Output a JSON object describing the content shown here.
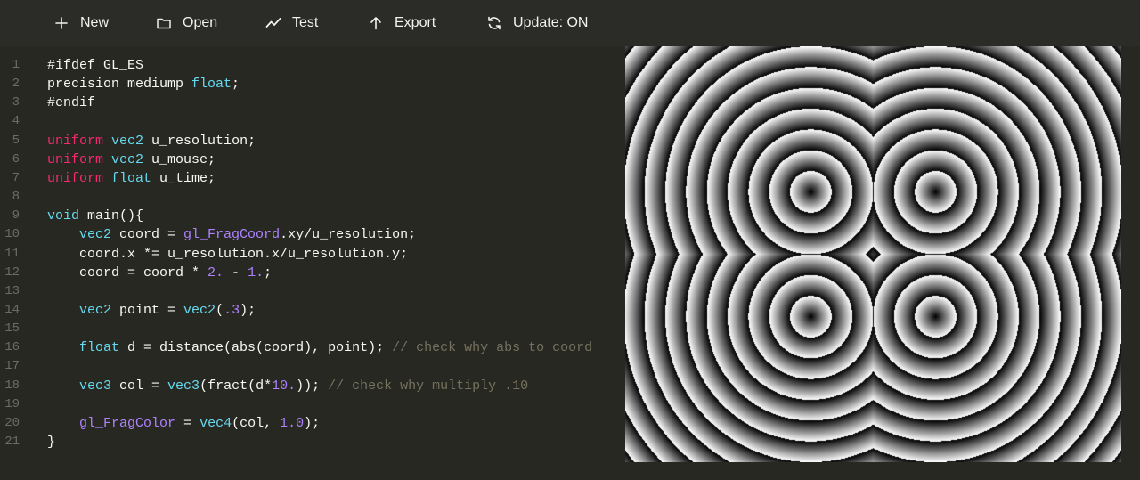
{
  "toolbar": {
    "new_label": "New",
    "open_label": "Open",
    "test_label": "Test",
    "export_label": "Export",
    "update_label": "Update: ON"
  },
  "editor": {
    "lines": [
      {
        "n": "1",
        "tokens": [
          {
            "t": "#ifdef GL_ES",
            "c": ""
          }
        ]
      },
      {
        "n": "2",
        "tokens": [
          {
            "t": "precision mediump ",
            "c": ""
          },
          {
            "t": "float",
            "c": "ty"
          },
          {
            "t": ";",
            "c": ""
          }
        ]
      },
      {
        "n": "3",
        "tokens": [
          {
            "t": "#endif",
            "c": ""
          }
        ]
      },
      {
        "n": "4",
        "tokens": []
      },
      {
        "n": "5",
        "tokens": [
          {
            "t": "uniform",
            "c": "kw"
          },
          {
            "t": " ",
            "c": ""
          },
          {
            "t": "vec2",
            "c": "ty"
          },
          {
            "t": " u_resolution;",
            "c": ""
          }
        ]
      },
      {
        "n": "6",
        "tokens": [
          {
            "t": "uniform",
            "c": "kw"
          },
          {
            "t": " ",
            "c": ""
          },
          {
            "t": "vec2",
            "c": "ty"
          },
          {
            "t": " u_mouse;",
            "c": ""
          }
        ]
      },
      {
        "n": "7",
        "tokens": [
          {
            "t": "uniform",
            "c": "kw"
          },
          {
            "t": " ",
            "c": ""
          },
          {
            "t": "float",
            "c": "ty"
          },
          {
            "t": " u_time;",
            "c": ""
          }
        ]
      },
      {
        "n": "8",
        "tokens": []
      },
      {
        "n": "9",
        "tokens": [
          {
            "t": "void",
            "c": "ty"
          },
          {
            "t": " main(){",
            "c": ""
          }
        ]
      },
      {
        "n": "10",
        "tokens": [
          {
            "t": "    ",
            "c": ""
          },
          {
            "t": "vec2",
            "c": "ty"
          },
          {
            "t": " coord = ",
            "c": ""
          },
          {
            "t": "gl_FragCoord",
            "c": "fn"
          },
          {
            "t": ".xy/u_resolution;",
            "c": ""
          }
        ]
      },
      {
        "n": "11",
        "tokens": [
          {
            "t": "    coord.x *= u_resolution.x/u_resolution.y;",
            "c": ""
          }
        ]
      },
      {
        "n": "12",
        "tokens": [
          {
            "t": "    coord = coord * ",
            "c": ""
          },
          {
            "t": "2.",
            "c": "num"
          },
          {
            "t": " - ",
            "c": ""
          },
          {
            "t": "1.",
            "c": "num"
          },
          {
            "t": ";",
            "c": ""
          }
        ]
      },
      {
        "n": "13",
        "tokens": []
      },
      {
        "n": "14",
        "tokens": [
          {
            "t": "    ",
            "c": ""
          },
          {
            "t": "vec2",
            "c": "ty"
          },
          {
            "t": " point = ",
            "c": ""
          },
          {
            "t": "vec2",
            "c": "ty"
          },
          {
            "t": "(",
            "c": ""
          },
          {
            "t": ".3",
            "c": "num"
          },
          {
            "t": ");",
            "c": ""
          }
        ]
      },
      {
        "n": "15",
        "tokens": []
      },
      {
        "n": "16",
        "tokens": [
          {
            "t": "    ",
            "c": ""
          },
          {
            "t": "float",
            "c": "ty"
          },
          {
            "t": " d = distance(abs(coord), point); ",
            "c": ""
          },
          {
            "t": "// check why abs to coord",
            "c": "cm"
          }
        ]
      },
      {
        "n": "17",
        "tokens": []
      },
      {
        "n": "18",
        "tokens": [
          {
            "t": "    ",
            "c": ""
          },
          {
            "t": "vec3",
            "c": "ty"
          },
          {
            "t": " col = ",
            "c": ""
          },
          {
            "t": "vec3",
            "c": "ty"
          },
          {
            "t": "(fract(d*",
            "c": ""
          },
          {
            "t": "10.",
            "c": "num"
          },
          {
            "t": ")); ",
            "c": ""
          },
          {
            "t": "// check why multiply .10",
            "c": "cm"
          }
        ]
      },
      {
        "n": "19",
        "tokens": []
      },
      {
        "n": "20",
        "tokens": [
          {
            "t": "    ",
            "c": ""
          },
          {
            "t": "gl_FragColor",
            "c": "fn"
          },
          {
            "t": " = ",
            "c": ""
          },
          {
            "t": "vec4",
            "c": "ty"
          },
          {
            "t": "(col, ",
            "c": ""
          },
          {
            "t": "1.0",
            "c": "num"
          },
          {
            "t": ");",
            "c": ""
          }
        ]
      },
      {
        "n": "21",
        "tokens": [
          {
            "t": "}",
            "c": ""
          }
        ]
      }
    ]
  },
  "preview": {
    "point": 0.3,
    "ring_frequency": 10.0
  },
  "colors": {
    "background": "#272822",
    "toolbar": "#2b2b28",
    "keyword": "#f92672",
    "type": "#66d9ef",
    "number": "#ae81ff",
    "comment": "#75715e"
  }
}
